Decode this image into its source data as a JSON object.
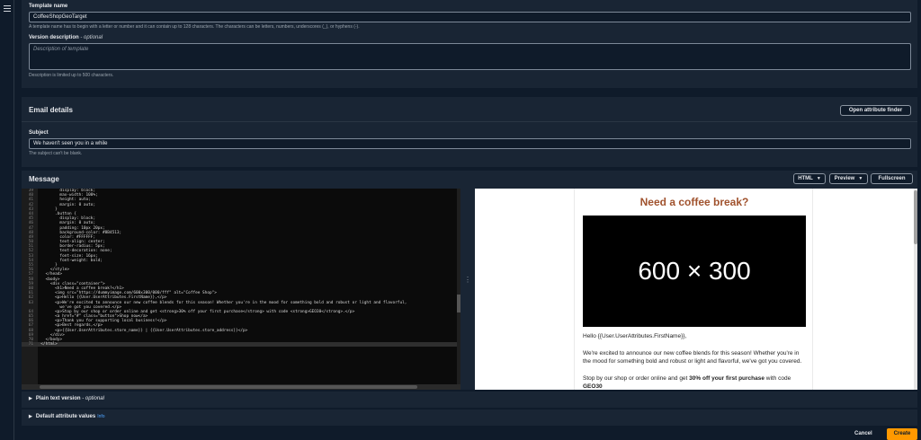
{
  "template": {
    "name_label": "Template name",
    "name_value": "CoffeeShopGeoTarget",
    "name_hint": "A template name has to begin with a letter or number and it can contain up to 128 characters. The characters can be letters, numbers, underscores (_), or hyphens (-).",
    "version_label": "Version description",
    "version_optional": "- optional",
    "version_placeholder": "Description of template",
    "version_hint": "Description is limited up to 500 characters."
  },
  "email_details": {
    "title": "Email details",
    "open_attr_button": "Open attribute finder",
    "subject_label": "Subject",
    "subject_value": "We haven't seen you in a while",
    "subject_hint": "The subject can't be blank."
  },
  "message": {
    "title": "Message",
    "format_select": "HTML",
    "preview_select": "Preview",
    "fullscreen_button": "Fullscreen",
    "code_lines": [
      {
        "n": "39",
        "t": "          display: block;"
      },
      {
        "n": "40",
        "t": "          max-width: 100%;"
      },
      {
        "n": "41",
        "t": "          height: auto;"
      },
      {
        "n": "42",
        "t": "          margin: 0 auto;"
      },
      {
        "n": "43",
        "t": "        }"
      },
      {
        "n": "44",
        "t": "        .button {"
      },
      {
        "n": "45",
        "t": "          display: block;"
      },
      {
        "n": "46",
        "t": "          margin: 0 auto;"
      },
      {
        "n": "47",
        "t": "          padding: 10px 20px;"
      },
      {
        "n": "48",
        "t": "          background-color: #8B4513;"
      },
      {
        "n": "49",
        "t": "          color: #FFFFFF;"
      },
      {
        "n": "50",
        "t": "          text-align: center;"
      },
      {
        "n": "51",
        "t": "          border-radius: 5px;"
      },
      {
        "n": "52",
        "t": "          text-decoration: none;"
      },
      {
        "n": "53",
        "t": "          font-size: 16px;"
      },
      {
        "n": "54",
        "t": "          font-weight: bold;"
      },
      {
        "n": "55",
        "t": "        }"
      },
      {
        "n": "56",
        "t": "      </style>"
      },
      {
        "n": "57",
        "t": "    </head>"
      },
      {
        "n": "58",
        "t": "    <body>"
      },
      {
        "n": "59",
        "t": "      <div class=\"container\">"
      },
      {
        "n": "60",
        "t": "        <h1>Need a coffee break?</h1>"
      },
      {
        "n": "61",
        "t": "        <img src=\"https://dummyimage.com/600x300/000/fff\" alt=\"Coffee Shop\">"
      },
      {
        "n": "62",
        "t": "        <p>Hello {{User.UserAttributes.FirstName}},</p>"
      },
      {
        "n": "63",
        "t": "        <p>We're excited to announce our new coffee blends for this season! Whether you're in the mood for something bold and robust or light and flavorful,"
      },
      {
        "n": "",
        "t": "          we've got you covered.</p>"
      },
      {
        "n": "64",
        "t": "        <p>Stop by our shop or order online and get <strong>30% off your first purchase</strong> with code <strong>GEO30</strong>.</p>"
      },
      {
        "n": "65",
        "t": "        <a href=\"#\" class=\"button\">Shop now</a>"
      },
      {
        "n": "66",
        "t": "        <p>Thank you for supporting local business!</p>"
      },
      {
        "n": "67",
        "t": "        <p>Best regards,</p>"
      },
      {
        "n": "68",
        "t": "        <p>{{User.UserAttributes.store_name}} | {{User.UserAttributes.store_address}}</p>"
      },
      {
        "n": "69",
        "t": "      </div>"
      },
      {
        "n": "70",
        "t": "    </body>"
      },
      {
        "n": "71",
        "t": "  </html>"
      }
    ],
    "preview": {
      "heading": "Need a coffee break?",
      "image_text": "600 × 300",
      "greeting": "Hello {{User.UserAttributes.FirstName}},",
      "para1": "We're excited to announce our new coffee blends for this season! Whether you're in the mood for something bold and robust or light and flavorful, we've got you covered.",
      "para2_start": "Stop by our shop or order online and get ",
      "para2_bold": "30% off your first purchase",
      "para2_end": " with code ",
      "para2_code": "GEO30"
    }
  },
  "plain_text": {
    "label": "Plain text version",
    "optional": "- optional"
  },
  "default_attrs": {
    "label": "Default attribute values",
    "info": "Info"
  },
  "footer": {
    "cancel": "Cancel",
    "create": "Create"
  }
}
